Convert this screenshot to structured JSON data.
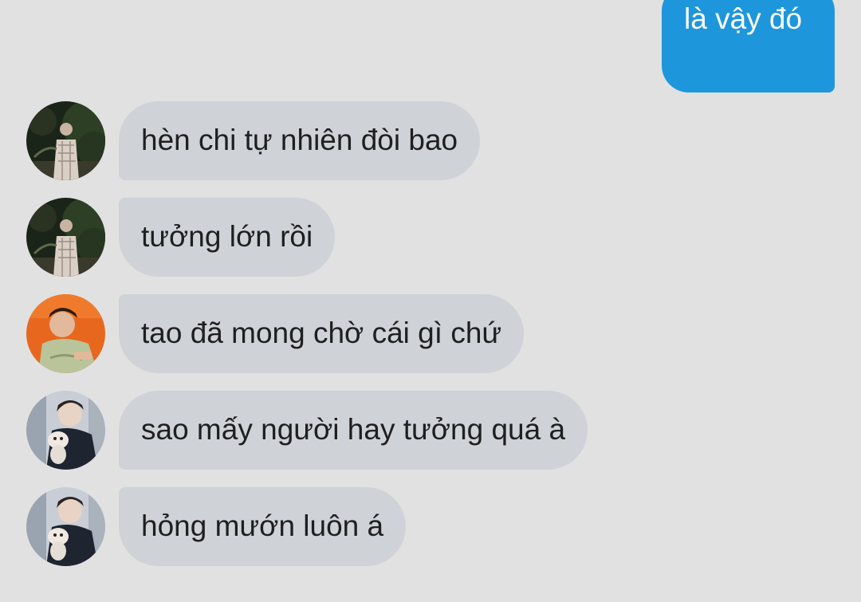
{
  "outgoing": [
    {
      "text": "là vậy đó"
    }
  ],
  "messages": [
    {
      "avatar": "avatar-night-photo",
      "text": "hèn chi tự nhiên đòi bao"
    },
    {
      "avatar": "avatar-night-photo",
      "text": "tưởng lớn rồi"
    },
    {
      "avatar": "avatar-orange-couch",
      "text": "tao đã mong chờ cái gì chứ"
    },
    {
      "avatar": "avatar-boy-with-dog",
      "text": "sao mấy người hay tưởng quá à"
    },
    {
      "avatar": "avatar-boy-with-dog",
      "text": "hỏng mướn luôn á"
    }
  ],
  "colors": {
    "background": "#e1e1e1",
    "outgoing_bubble": "#1e96dc",
    "incoming_bubble": "#cfd2d7"
  }
}
